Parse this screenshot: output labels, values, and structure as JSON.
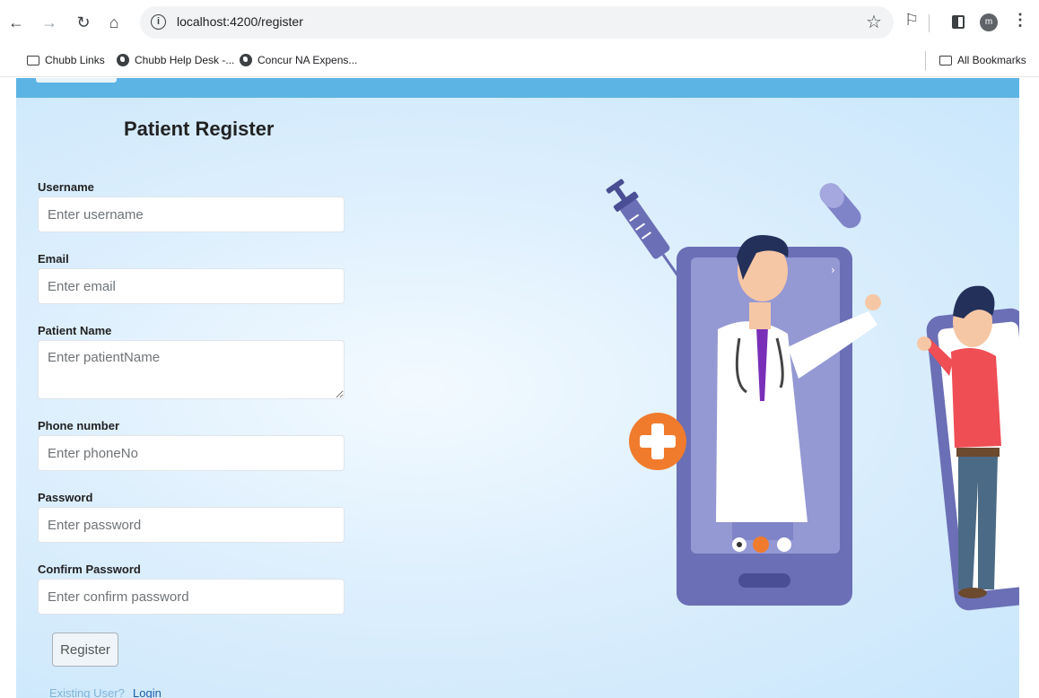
{
  "browser": {
    "url": "localhost:4200/register",
    "avatar_letter": "m",
    "bookmarks": [
      "Chubb Links",
      "Chubb Help Desk -...",
      "Concur NA Expens..."
    ],
    "all_bookmarks": "All Bookmarks"
  },
  "form": {
    "title": "Patient Register",
    "fields": [
      {
        "label": "Username",
        "placeholder": "Enter username"
      },
      {
        "label": "Email",
        "placeholder": "Enter email"
      },
      {
        "label": "Patient Name",
        "placeholder": "Enter patientName"
      },
      {
        "label": "Phone number",
        "placeholder": "Enter phoneNo"
      },
      {
        "label": "Password",
        "placeholder": "Enter password"
      },
      {
        "label": "Confirm Password",
        "placeholder": "Enter confirm password"
      }
    ],
    "submit_label": "Register",
    "existing_user_text": "Existing User?",
    "login_link": "Login"
  },
  "colors": {
    "nav_bar": "#5cb4e4",
    "phone_frame": "#6b6fb5",
    "accent_orange": "#f07b2d"
  }
}
